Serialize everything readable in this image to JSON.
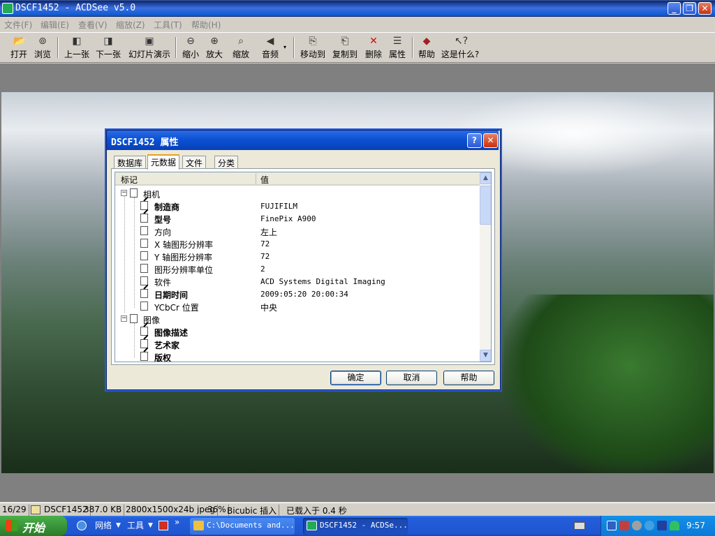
{
  "window": {
    "title": "DSCF1452 - ACDSee v5.0",
    "minimize": "_",
    "restore": "❐",
    "close": "✕"
  },
  "menu": [
    "文件(F)",
    "编辑(E)",
    "查看(V)",
    "缩放(Z)",
    "工具(T)",
    "帮助(H)"
  ],
  "toolbar": [
    {
      "name": "open",
      "label": "打开",
      "icon": "folder-open-icon"
    },
    {
      "name": "browse",
      "label": "浏览",
      "icon": "binoculars-icon"
    },
    {
      "name": "prev",
      "label": "上一张",
      "icon": "prev-image-icon"
    },
    {
      "name": "next",
      "label": "下一张",
      "icon": "next-image-icon"
    },
    {
      "name": "slideshow",
      "label": "幻灯片演示",
      "icon": "slideshow-icon"
    },
    {
      "name": "zoom-out",
      "label": "缩小",
      "icon": "zoom-out-icon"
    },
    {
      "name": "zoom-in",
      "label": "放大",
      "icon": "zoom-in-icon"
    },
    {
      "name": "zoom",
      "label": "缩放",
      "icon": "zoom-icon"
    },
    {
      "name": "audio",
      "label": "音频",
      "icon": "speaker-icon"
    },
    {
      "name": "move-to",
      "label": "移动到",
      "icon": "move-to-icon"
    },
    {
      "name": "copy-to",
      "label": "复制到",
      "icon": "copy-to-icon"
    },
    {
      "name": "delete",
      "label": "删除",
      "icon": "delete-x-icon"
    },
    {
      "name": "properties",
      "label": "属性",
      "icon": "properties-icon"
    },
    {
      "name": "help",
      "label": "帮助",
      "icon": "help-book-icon"
    },
    {
      "name": "whats-this",
      "label": "这是什么?",
      "icon": "whats-this-icon"
    }
  ],
  "dialog": {
    "title": "DSCF1452 属性",
    "tabs": [
      "数据库",
      "元数据",
      "文件",
      "分类"
    ],
    "active_tab": "元数据",
    "columns": [
      "标记",
      "值"
    ],
    "groups": [
      {
        "label": "相机",
        "expander": "−",
        "rows": [
          {
            "label": "制造商",
            "value": "FUJIFILM",
            "bold": true
          },
          {
            "label": "型号",
            "value": "FinePix A900",
            "bold": true
          },
          {
            "label": "方向",
            "value": "左上",
            "bold": false
          },
          {
            "label": "X 轴图形分辨率",
            "value": "72",
            "bold": false
          },
          {
            "label": "Y 轴图形分辨率",
            "value": "72",
            "bold": false
          },
          {
            "label": "图形分辨率单位",
            "value": "2",
            "bold": false
          },
          {
            "label": "软件",
            "value": "ACD Systems Digital Imaging",
            "bold": false
          },
          {
            "label": "日期时间",
            "value": "2009:05:20 20:00:34",
            "bold": true
          },
          {
            "label": "YCbCr 位置",
            "value": "中央",
            "bold": false
          }
        ]
      },
      {
        "label": "图像",
        "expander": "−",
        "rows": [
          {
            "label": "图像描述",
            "value": "",
            "bold": true
          },
          {
            "label": "艺术家",
            "value": "",
            "bold": true
          },
          {
            "label": "版权",
            "value": "",
            "bold": true
          }
        ]
      }
    ],
    "buttons": {
      "help_glyph": "?",
      "close_glyph": "✕",
      "ok": "确定",
      "cancel": "取消",
      "help": "帮助"
    }
  },
  "statusbar": {
    "index": "16/29",
    "filename": "DSCF1452",
    "size": "387.0 KB",
    "dimensions": "2800x1500x24b jpeg",
    "zoom": "36%",
    "resample": "Bicubic 插入",
    "load_time": "已载入于 0.4 秒"
  },
  "taskbar": {
    "start": "开始",
    "quick": [
      {
        "label": "网络"
      },
      {
        "label": "工具"
      }
    ],
    "overflow": "»",
    "tasks": [
      {
        "label": "C:\\Documents and...",
        "active": false
      },
      {
        "label": "DSCF1452 - ACDSe...",
        "active": true
      }
    ],
    "clock": "9:57"
  },
  "colors": {
    "titlebar": "#0a58d0",
    "dialog_bg": "#ece9d8",
    "taskbar": "#245edb",
    "start": "#3a963a"
  }
}
